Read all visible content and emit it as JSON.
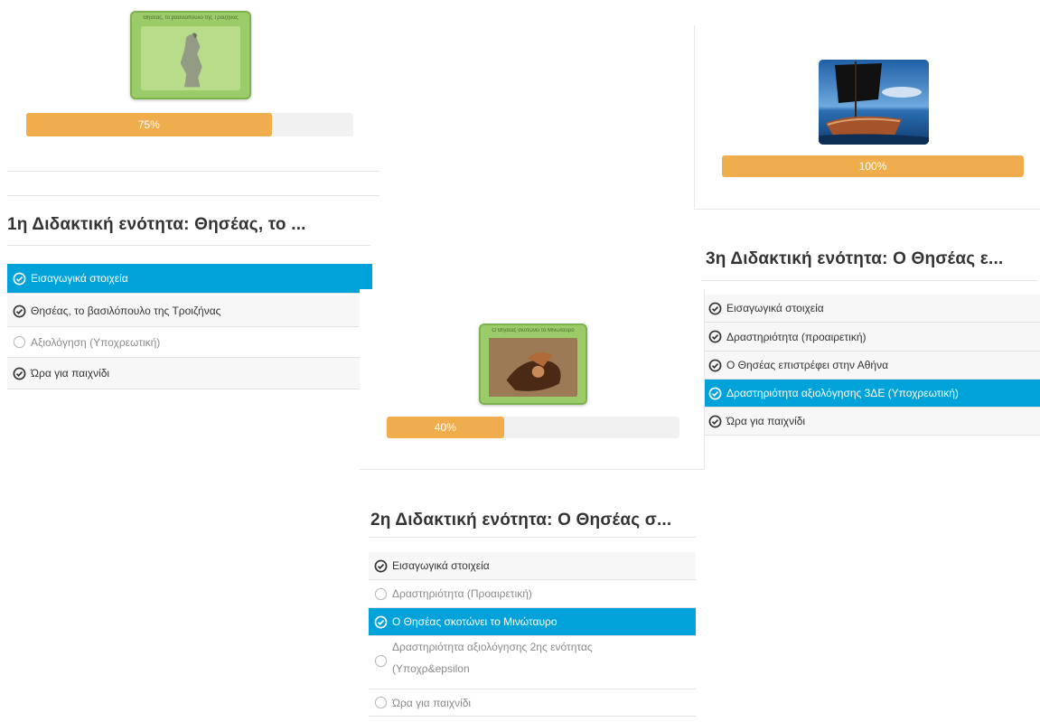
{
  "panel1": {
    "thumb_caption": "Θησέας, το βασιλόπουλο της Τροιζήνας",
    "progress": {
      "value": 75,
      "label": "75%"
    },
    "title": "1η Διδακτική ενότητα: Θησέας, το ...",
    "items": [
      {
        "label": "Εισαγωγικά στοιχεία",
        "status": "completed",
        "icon": "check-circle-icon",
        "active": true
      },
      {
        "label": "Θησέας, το βασιλόπουλο της Τροιζήνας",
        "status": "completed",
        "icon": "check-circle-icon",
        "active": false
      },
      {
        "label": "Αξιολόγηση (Υποχρεωτική)",
        "status": "pending",
        "icon": "empty-circle-icon",
        "active": false
      },
      {
        "label": "Ώρα για παιχνίδι",
        "status": "completed",
        "icon": "check-circle-icon",
        "active": false
      }
    ]
  },
  "panel2": {
    "thumb_caption": "Ο Θησέας σκοτώνει το Μινώταυρο",
    "progress": {
      "value": 40,
      "label": "40%"
    },
    "title": "2η Διδακτική ενότητα: Ο Θησέας σ...",
    "items": [
      {
        "label": "Εισαγωγικά στοιχεία",
        "status": "completed",
        "icon": "check-circle-icon",
        "active": false
      },
      {
        "label": "Δραστηριότητα (Προαιρετική)",
        "status": "pending",
        "icon": "empty-circle-icon",
        "active": false
      },
      {
        "label": "Ο Θησέας σκοτώνει το Μινώταυρο",
        "status": "completed",
        "icon": "check-circle-icon",
        "active": true
      },
      {
        "label": "Δραστηριότητα αξιολόγησης 2ης ενότητας",
        "label2": "(Υποχρ&epsilon",
        "status": "pending",
        "icon": "empty-circle-icon",
        "active": false
      },
      {
        "label": "Ώρα για παιχνίδι",
        "status": "pending",
        "icon": "empty-circle-icon",
        "active": false
      }
    ]
  },
  "panel3": {
    "progress": {
      "value": 100,
      "label": "100%"
    },
    "title": "3η Διδακτική ενότητα: Ο Θησέας ε...",
    "items": [
      {
        "label": "Εισαγωγικά στοιχεία",
        "status": "completed",
        "icon": "check-circle-icon",
        "active": false
      },
      {
        "label": "Δραστηριότητα (προαιρετική)",
        "status": "completed",
        "icon": "check-circle-icon",
        "active": false
      },
      {
        "label": "Ο Θησέας επιστρέφει στην Αθήνα",
        "status": "completed",
        "icon": "check-circle-icon",
        "active": false
      },
      {
        "label": "Δραστηριότητα αξιολόγησης 3ΔΕ (Υποχρεωτική)",
        "status": "completed",
        "icon": "check-circle-icon",
        "active": true
      },
      {
        "label": "Ώρα για παιχνίδι",
        "status": "completed",
        "icon": "check-circle-icon",
        "active": false
      }
    ]
  },
  "colors": {
    "accent_active": "#00a3d9",
    "progress_fill": "#f0ad4e",
    "progress_track": "#f1f1f1",
    "thumb_green": "#9ccc6a"
  }
}
